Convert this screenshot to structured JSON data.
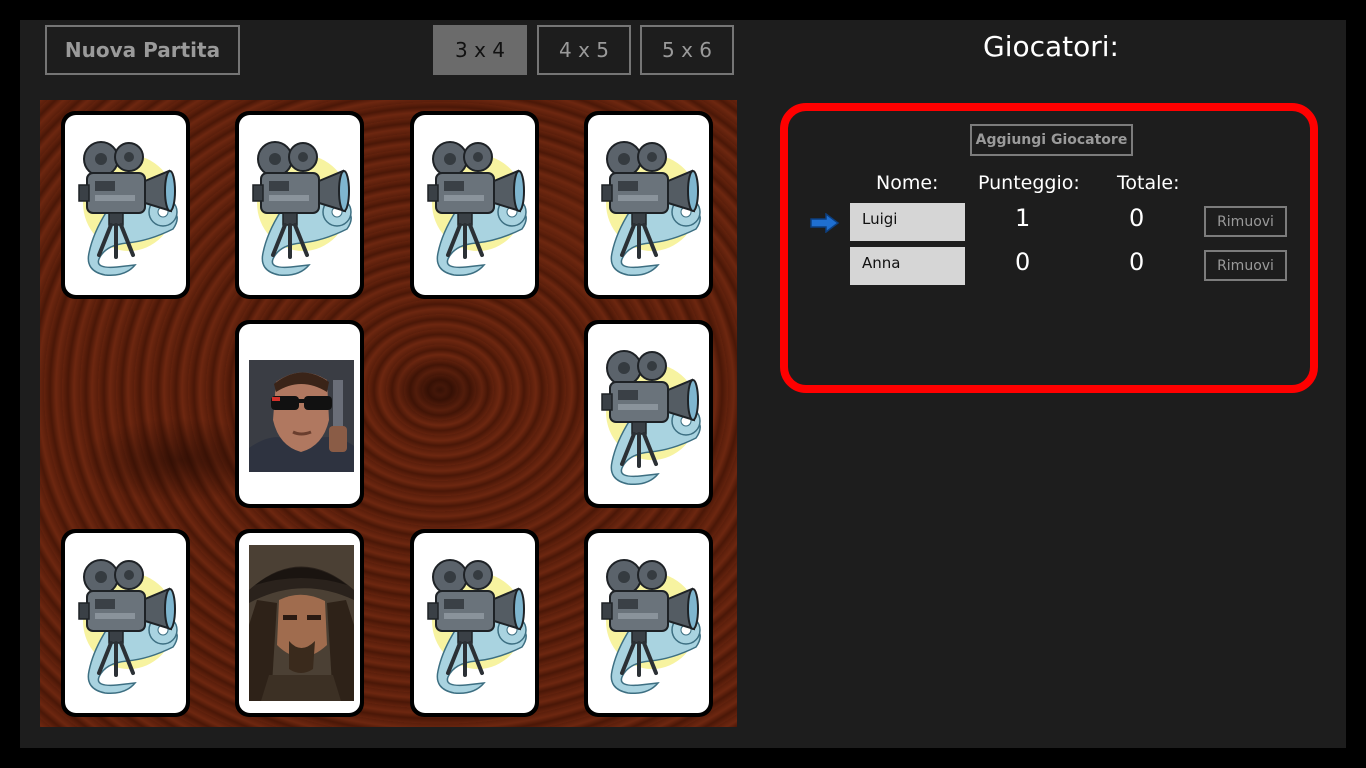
{
  "toolbar": {
    "new_game_label": "Nuova Partita",
    "sizes": [
      "3 x 4",
      "4 x 5",
      "5 x 6"
    ],
    "active_size": "3 x 4"
  },
  "players_panel": {
    "title": "Giocatori:",
    "add_player_label": "Aggiungi Giocatore",
    "columns": {
      "name": "Nome:",
      "score": "Punteggio:",
      "total": "Totale:"
    },
    "players": [
      {
        "name": "Luigi",
        "score": "1",
        "total": "0",
        "remove_label": "Rimuovi",
        "current": true
      },
      {
        "name": "Anna",
        "score": "0",
        "total": "0",
        "remove_label": "Rimuovi",
        "current": false
      }
    ],
    "highlight_color": "#ff0000",
    "arrow_color": "#1f6fd1"
  },
  "board": {
    "grid": "3 x 4",
    "cards": [
      {
        "state": "face-down",
        "icon": "movie-camera-icon"
      },
      {
        "state": "face-down",
        "icon": "movie-camera-icon"
      },
      {
        "state": "face-down",
        "icon": "movie-camera-icon"
      },
      {
        "state": "face-down",
        "icon": "movie-camera-icon"
      },
      {
        "state": "removed"
      },
      {
        "state": "face-up",
        "icon": "terminator-photo"
      },
      {
        "state": "removed"
      },
      {
        "state": "face-down",
        "icon": "movie-camera-icon"
      },
      {
        "state": "face-down",
        "icon": "movie-camera-icon"
      },
      {
        "state": "face-up",
        "icon": "jack-sparrow-photo"
      },
      {
        "state": "face-down",
        "icon": "movie-camera-icon"
      },
      {
        "state": "face-down",
        "icon": "movie-camera-icon"
      }
    ]
  }
}
